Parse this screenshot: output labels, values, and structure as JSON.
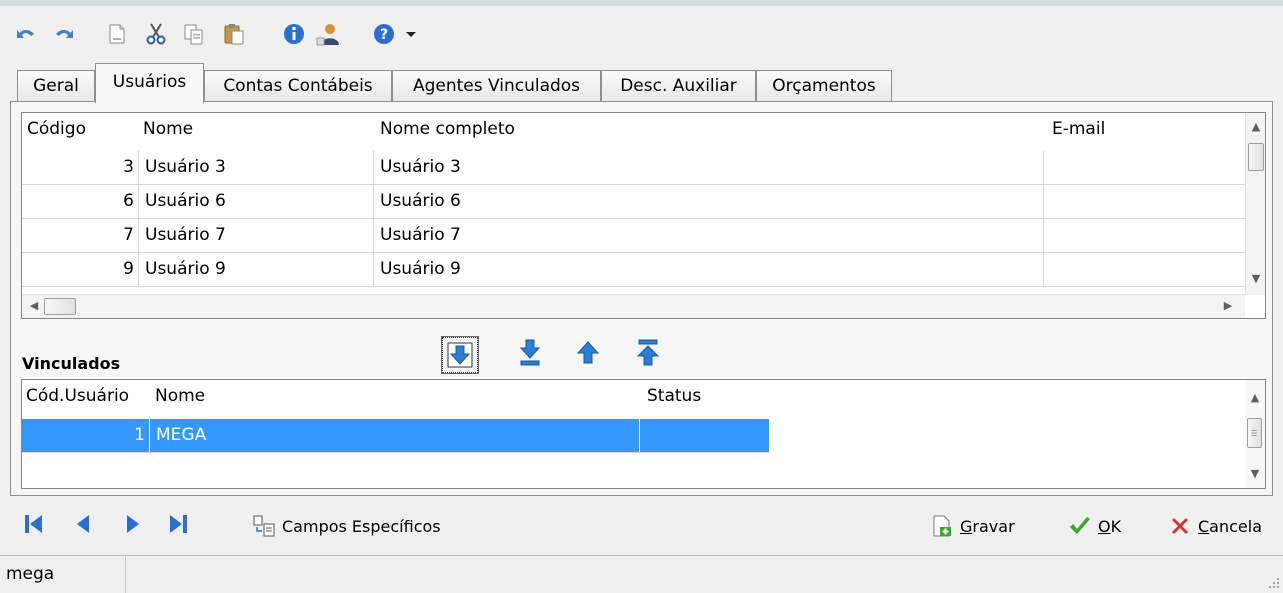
{
  "toolbar": {
    "icons": [
      "undo-icon",
      "redo-icon",
      "new-document-icon",
      "cut-icon",
      "copy-icon",
      "paste-icon",
      "info-icon",
      "user-icon",
      "help-icon",
      "dropdown-arrow-icon"
    ]
  },
  "tabs": [
    {
      "label": "Geral",
      "active": false
    },
    {
      "label": "Usuários",
      "active": true
    },
    {
      "label": "Contas Contábeis",
      "active": false
    },
    {
      "label": "Agentes Vinculados",
      "active": false
    },
    {
      "label": "Desc. Auxiliar",
      "active": false
    },
    {
      "label": "Orçamentos",
      "active": false
    }
  ],
  "users_grid": {
    "columns": [
      "Código",
      "Nome",
      "Nome completo",
      "E-mail"
    ],
    "rows": [
      {
        "codigo": "3",
        "nome": "Usuário 3",
        "nome_completo": "Usuário 3",
        "email": ""
      },
      {
        "codigo": "6",
        "nome": "Usuário 6",
        "nome_completo": "Usuário 6",
        "email": ""
      },
      {
        "codigo": "7",
        "nome": "Usuário 7",
        "nome_completo": "Usuário 7",
        "email": ""
      },
      {
        "codigo": "9",
        "nome": "Usuário 9",
        "nome_completo": "Usuário 9",
        "email": ""
      }
    ]
  },
  "move_buttons": [
    "move-selected-down-icon",
    "move-all-down-icon",
    "move-up-icon",
    "move-all-up-icon"
  ],
  "vinculados": {
    "label": "Vinculados",
    "columns": [
      "Cód.Usuário",
      "Nome",
      "Status"
    ],
    "rows": [
      {
        "cod_usuario": "1",
        "nome": "MEGA",
        "status": "",
        "selected": true
      }
    ]
  },
  "bottom": {
    "nav_icons": [
      "first-record-icon",
      "previous-record-icon",
      "next-record-icon",
      "last-record-icon"
    ],
    "campos_label": "Campos Específicos",
    "gravar_label": "Gravar",
    "gravar_mnemonic": "G",
    "gravar_rest": "ravar",
    "ok_label": "OK",
    "ok_mnemonic": "O",
    "ok_rest": "K",
    "cancela_label": "Cancela",
    "cancela_mnemonic": "C",
    "cancela_rest": "ancela"
  },
  "status_bar": {
    "user": "mega"
  },
  "colors": {
    "selection": "#3399ff",
    "arrow_blue": "#2a7fd4",
    "ok_green": "#3aa829",
    "cancel_red": "#d9342b"
  }
}
